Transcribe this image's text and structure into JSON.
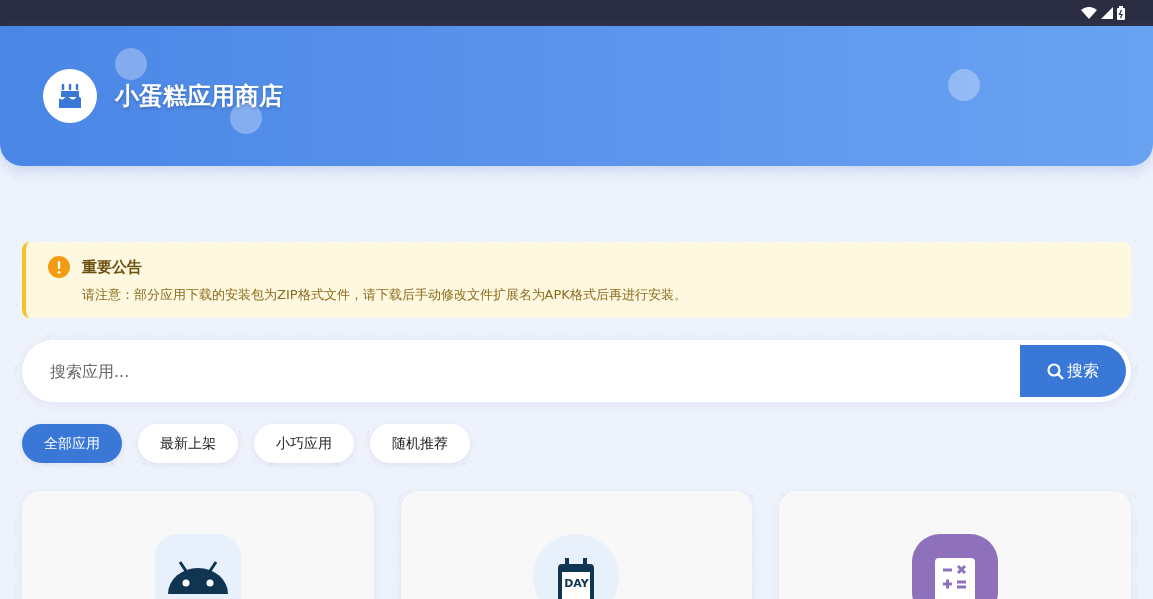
{
  "header": {
    "title": "小蛋糕应用商店"
  },
  "notice": {
    "title": "重要公告",
    "text": "请注意：部分应用下载的安装包为ZIP格式文件，请下载后手动修改文件扩展名为APK格式后再进行安装。"
  },
  "search": {
    "placeholder": "搜索应用...",
    "button": "搜索"
  },
  "filters": [
    {
      "label": "全部应用",
      "selected": true
    },
    {
      "label": "最新上架",
      "selected": false
    },
    {
      "label": "小巧应用",
      "selected": false
    },
    {
      "label": "随机推荐",
      "selected": false
    }
  ],
  "apps": [
    {
      "kind": "android"
    },
    {
      "kind": "calendar",
      "icon_text": "DAY"
    },
    {
      "kind": "calculator"
    }
  ]
}
